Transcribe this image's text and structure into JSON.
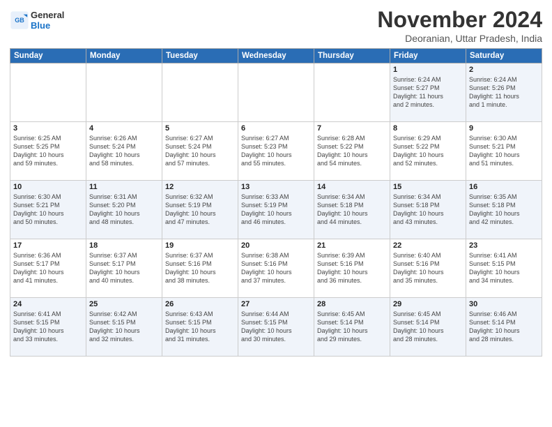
{
  "header": {
    "logo_line1": "General",
    "logo_line2": "Blue",
    "title": "November 2024",
    "location": "Deoranian, Uttar Pradesh, India"
  },
  "weekdays": [
    "Sunday",
    "Monday",
    "Tuesday",
    "Wednesday",
    "Thursday",
    "Friday",
    "Saturday"
  ],
  "weeks": [
    [
      {
        "day": "",
        "detail": ""
      },
      {
        "day": "",
        "detail": ""
      },
      {
        "day": "",
        "detail": ""
      },
      {
        "day": "",
        "detail": ""
      },
      {
        "day": "",
        "detail": ""
      },
      {
        "day": "1",
        "detail": "Sunrise: 6:24 AM\nSunset: 5:27 PM\nDaylight: 11 hours\nand 2 minutes."
      },
      {
        "day": "2",
        "detail": "Sunrise: 6:24 AM\nSunset: 5:26 PM\nDaylight: 11 hours\nand 1 minute."
      }
    ],
    [
      {
        "day": "3",
        "detail": "Sunrise: 6:25 AM\nSunset: 5:25 PM\nDaylight: 10 hours\nand 59 minutes."
      },
      {
        "day": "4",
        "detail": "Sunrise: 6:26 AM\nSunset: 5:24 PM\nDaylight: 10 hours\nand 58 minutes."
      },
      {
        "day": "5",
        "detail": "Sunrise: 6:27 AM\nSunset: 5:24 PM\nDaylight: 10 hours\nand 57 minutes."
      },
      {
        "day": "6",
        "detail": "Sunrise: 6:27 AM\nSunset: 5:23 PM\nDaylight: 10 hours\nand 55 minutes."
      },
      {
        "day": "7",
        "detail": "Sunrise: 6:28 AM\nSunset: 5:22 PM\nDaylight: 10 hours\nand 54 minutes."
      },
      {
        "day": "8",
        "detail": "Sunrise: 6:29 AM\nSunset: 5:22 PM\nDaylight: 10 hours\nand 52 minutes."
      },
      {
        "day": "9",
        "detail": "Sunrise: 6:30 AM\nSunset: 5:21 PM\nDaylight: 10 hours\nand 51 minutes."
      }
    ],
    [
      {
        "day": "10",
        "detail": "Sunrise: 6:30 AM\nSunset: 5:21 PM\nDaylight: 10 hours\nand 50 minutes."
      },
      {
        "day": "11",
        "detail": "Sunrise: 6:31 AM\nSunset: 5:20 PM\nDaylight: 10 hours\nand 48 minutes."
      },
      {
        "day": "12",
        "detail": "Sunrise: 6:32 AM\nSunset: 5:19 PM\nDaylight: 10 hours\nand 47 minutes."
      },
      {
        "day": "13",
        "detail": "Sunrise: 6:33 AM\nSunset: 5:19 PM\nDaylight: 10 hours\nand 46 minutes."
      },
      {
        "day": "14",
        "detail": "Sunrise: 6:34 AM\nSunset: 5:18 PM\nDaylight: 10 hours\nand 44 minutes."
      },
      {
        "day": "15",
        "detail": "Sunrise: 6:34 AM\nSunset: 5:18 PM\nDaylight: 10 hours\nand 43 minutes."
      },
      {
        "day": "16",
        "detail": "Sunrise: 6:35 AM\nSunset: 5:18 PM\nDaylight: 10 hours\nand 42 minutes."
      }
    ],
    [
      {
        "day": "17",
        "detail": "Sunrise: 6:36 AM\nSunset: 5:17 PM\nDaylight: 10 hours\nand 41 minutes."
      },
      {
        "day": "18",
        "detail": "Sunrise: 6:37 AM\nSunset: 5:17 PM\nDaylight: 10 hours\nand 40 minutes."
      },
      {
        "day": "19",
        "detail": "Sunrise: 6:37 AM\nSunset: 5:16 PM\nDaylight: 10 hours\nand 38 minutes."
      },
      {
        "day": "20",
        "detail": "Sunrise: 6:38 AM\nSunset: 5:16 PM\nDaylight: 10 hours\nand 37 minutes."
      },
      {
        "day": "21",
        "detail": "Sunrise: 6:39 AM\nSunset: 5:16 PM\nDaylight: 10 hours\nand 36 minutes."
      },
      {
        "day": "22",
        "detail": "Sunrise: 6:40 AM\nSunset: 5:16 PM\nDaylight: 10 hours\nand 35 minutes."
      },
      {
        "day": "23",
        "detail": "Sunrise: 6:41 AM\nSunset: 5:15 PM\nDaylight: 10 hours\nand 34 minutes."
      }
    ],
    [
      {
        "day": "24",
        "detail": "Sunrise: 6:41 AM\nSunset: 5:15 PM\nDaylight: 10 hours\nand 33 minutes."
      },
      {
        "day": "25",
        "detail": "Sunrise: 6:42 AM\nSunset: 5:15 PM\nDaylight: 10 hours\nand 32 minutes."
      },
      {
        "day": "26",
        "detail": "Sunrise: 6:43 AM\nSunset: 5:15 PM\nDaylight: 10 hours\nand 31 minutes."
      },
      {
        "day": "27",
        "detail": "Sunrise: 6:44 AM\nSunset: 5:15 PM\nDaylight: 10 hours\nand 30 minutes."
      },
      {
        "day": "28",
        "detail": "Sunrise: 6:45 AM\nSunset: 5:14 PM\nDaylight: 10 hours\nand 29 minutes."
      },
      {
        "day": "29",
        "detail": "Sunrise: 6:45 AM\nSunset: 5:14 PM\nDaylight: 10 hours\nand 28 minutes."
      },
      {
        "day": "30",
        "detail": "Sunrise: 6:46 AM\nSunset: 5:14 PM\nDaylight: 10 hours\nand 28 minutes."
      }
    ]
  ]
}
